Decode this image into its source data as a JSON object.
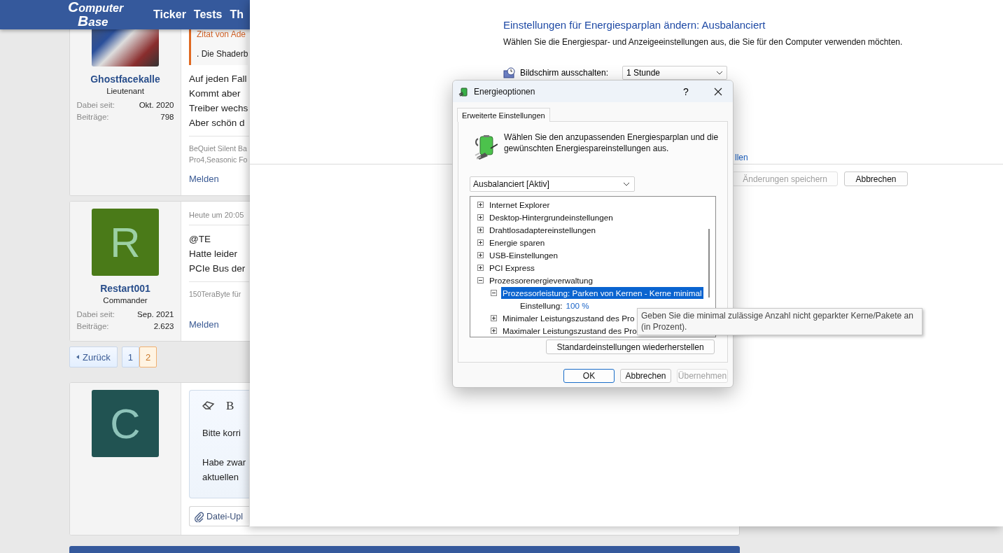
{
  "forum": {
    "logo": [
      "Computer",
      "Base"
    ],
    "nav": [
      "Ticker",
      "Tests",
      "Th"
    ],
    "posts": [
      {
        "avatar": {
          "kind": "photo"
        },
        "author": "Ghostfacekalle",
        "rank": "Lieutenant",
        "stats": [
          {
            "label": "Dabei seit:",
            "value": "Okt. 2020"
          },
          {
            "label": "Beiträge:",
            "value": "798"
          }
        ],
        "quote": {
          "source": "Zitat von Ade",
          "text": ". Die Shaderb"
        },
        "body": [
          "Auf jeden Fall",
          "Kommt aber",
          "Treiber wechs",
          "Aber schön d"
        ],
        "signature": [
          "BeQuiet Silent Ba",
          "Pro4,Seasonic Fo"
        ],
        "action": "Melden"
      },
      {
        "avatar": {
          "kind": "letter",
          "letter": "R",
          "color": "#4a7a18"
        },
        "author": "Restart001",
        "rank": "Commander",
        "stats": [
          {
            "label": "Dabei seit:",
            "value": "Sep. 2021"
          },
          {
            "label": "Beiträge:",
            "value": "2.623"
          }
        ],
        "time": "Heute um 20:05",
        "body": [
          "@TE",
          "Hatte leider",
          "PCIe Bus der"
        ],
        "signature": [
          "150TeraByte für"
        ],
        "action": "Melden"
      }
    ],
    "pagination": {
      "back": "Zurück",
      "pages": [
        {
          "label": "1",
          "selected": false
        },
        {
          "label": "2",
          "selected": true
        }
      ]
    },
    "reply": {
      "avatar": {
        "kind": "letter",
        "letter": "C",
        "color": "#215352"
      },
      "toolbar": [
        "B"
      ],
      "paragraphs": [
        [
          "Bitte korri"
        ],
        [
          "Habe zwar",
          "aktuellen"
        ]
      ],
      "upload": "Datei-Upl"
    }
  },
  "control_panel": {
    "title": "Einstellungen für Energiesparplan ändern: Ausbalanciert",
    "subtitle": "Wählen Sie die Energiespar- und Anzeigeeinstellungen aus, die Sie für den Computer verwenden möchten.",
    "settings": [
      {
        "label": "Bildschirm ausschalten:",
        "value": "1 Stunde"
      }
    ],
    "link": "llen",
    "buttons": [
      {
        "label": "Änderungen speichern",
        "disabled": true
      },
      {
        "label": "Abbrechen",
        "disabled": false
      }
    ]
  },
  "dialog": {
    "title": "Energieoptionen",
    "help": "?",
    "tabs": [
      {
        "label": "Erweiterte Einstellungen",
        "selected": true
      }
    ],
    "description": "Wählen Sie den anzupassenden Energiesparplan und die gewünschten Energiespareinstellungen aus.",
    "plan": "Ausbalanciert [Aktiv]",
    "tree": [
      {
        "kind": "node",
        "label": "Internet Explorer",
        "expanded": false,
        "selected": false
      },
      {
        "kind": "node",
        "label": "Desktop-Hintergrundeinstellungen",
        "expanded": false,
        "selected": false
      },
      {
        "kind": "node",
        "label": "Drahtlosadaptereinstellungen",
        "expanded": false,
        "selected": false
      },
      {
        "kind": "node",
        "label": "Energie sparen",
        "expanded": false,
        "selected": false
      },
      {
        "kind": "node",
        "label": "USB-Einstellungen",
        "expanded": false,
        "selected": false
      },
      {
        "kind": "node",
        "label": "PCI Express",
        "expanded": false,
        "selected": false
      },
      {
        "kind": "node",
        "label": "Prozessorenergieverwaltung",
        "expanded": true,
        "selected": false,
        "children": [
          {
            "kind": "node",
            "label": "Prozessorleistung: Parken von Kernen - Kerne minimal",
            "expanded": true,
            "selected": true,
            "children": [
              {
                "kind": "setting",
                "label": "Einstellung:",
                "value": "100 %"
              }
            ]
          },
          {
            "kind": "node",
            "label": "Minimaler Leistungszustand des Pro",
            "expanded": false,
            "selected": false
          },
          {
            "kind": "node",
            "label": "Maximaler Leistungszustand des Pro",
            "expanded": false,
            "selected": false
          }
        ]
      }
    ],
    "restore": "Standardeinstellungen wiederherstellen",
    "buttons": [
      {
        "label": "OK",
        "default": true,
        "disabled": false
      },
      {
        "label": "Abbrechen",
        "default": false,
        "disabled": false
      },
      {
        "label": "Übernehmen",
        "default": false,
        "disabled": true
      }
    ]
  },
  "tooltip": {
    "text": "Geben Sie die minimal zulässige Anzahl nicht geparkter Kerne/Pakete an (in Prozent)."
  }
}
